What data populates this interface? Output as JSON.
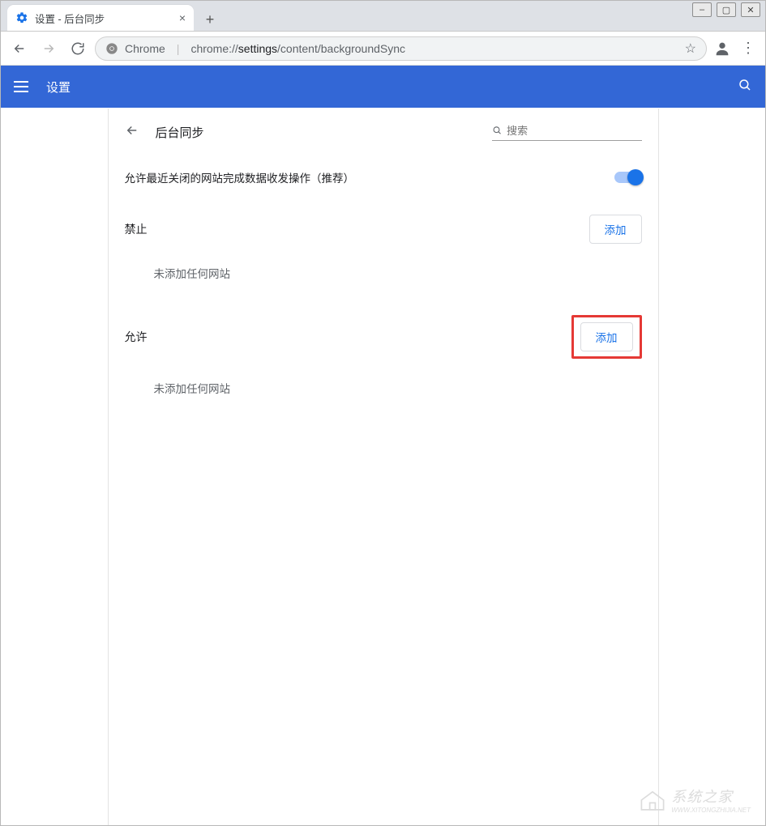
{
  "window": {
    "tab_title": "设置 - 后台同步"
  },
  "omnibox": {
    "scheme_label": "Chrome",
    "url_host": "chrome://",
    "url_bold": "settings",
    "url_rest": "/content/backgroundSync"
  },
  "settings_bar": {
    "title": "设置"
  },
  "page": {
    "section_title": "后台同步",
    "search_placeholder": "搜索",
    "toggle_label": "允许最近关闭的网站完成数据收发操作（推荐）",
    "block": {
      "heading": "禁止",
      "add_label": "添加",
      "empty": "未添加任何网站"
    },
    "allow": {
      "heading": "允许",
      "add_label": "添加",
      "empty": "未添加任何网站"
    }
  },
  "watermark": {
    "text": "系统之家",
    "sub": "WWW.XITONGZHIJIA.NET"
  }
}
